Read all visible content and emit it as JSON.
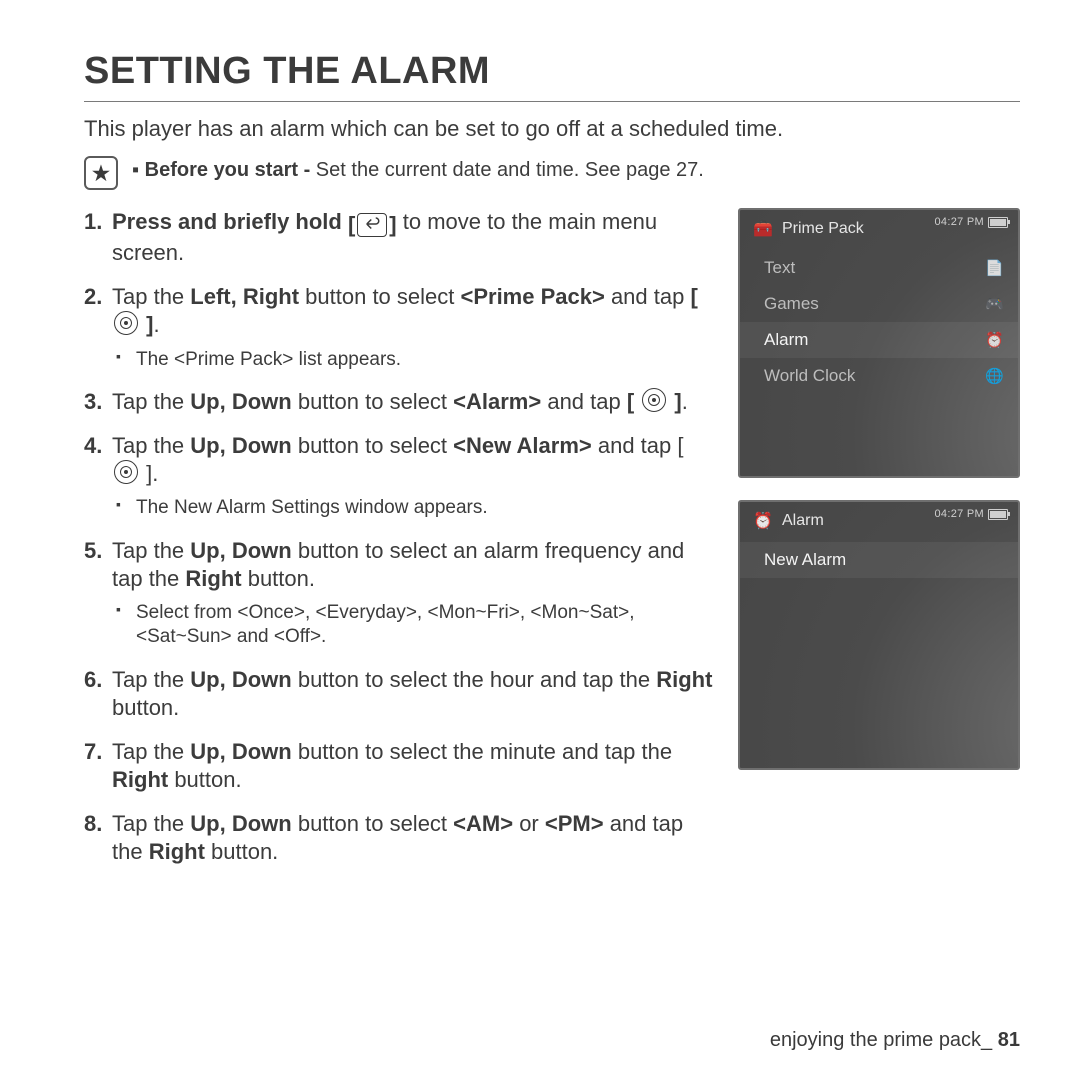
{
  "title": "SETTING THE ALARM",
  "intro": "This player has an alarm which can be set to go off at a scheduled time.",
  "note": {
    "lead": "Before you start -",
    "rest": " Set the current date and time. See page 27."
  },
  "steps": {
    "s1a": "Press and briefly hold ",
    "s1b": " to move to the main menu screen.",
    "s2a": "Tap the ",
    "s2b": "Left, Right",
    "s2c": " button to select ",
    "s2d": "<Prime Pack>",
    "s2e": " and tap ",
    "s2sub": "The <Prime Pack> list appears.",
    "s3a": "Tap the ",
    "s3b": "Up, Down",
    "s3c": " button to select ",
    "s3d": "<Alarm>",
    "s3e": " and tap ",
    "s4a": "Tap the ",
    "s4b": "Up, Down",
    "s4c": " button to select ",
    "s4d": "<New Alarm>",
    "s4e": " and tap ",
    "s4sub": "The New Alarm Settings window appears.",
    "s5a": "Tap the ",
    "s5b": "Up, Down",
    "s5c": " button to select an alarm frequency and tap the ",
    "s5d": "Right",
    "s5e": " button.",
    "s5sub": "Select from <Once>, <Everyday>, <Mon~Fri>, <Mon~Sat>, <Sat~Sun> and <Off>.",
    "s6a": "Tap the ",
    "s6b": "Up, Down",
    "s6c": " button to select the hour and tap the ",
    "s6d": "Right",
    "s6e": " button.",
    "s7a": "Tap the ",
    "s7b": "Up, Down",
    "s7c": " button to select the minute and tap the ",
    "s7d": "Right",
    "s7e": " button.",
    "s8a": "Tap the ",
    "s8b": "Up, Down",
    "s8c": " button to select ",
    "s8d": "<AM>",
    "s8e": " or ",
    "s8f": "<PM>",
    "s8g": " and tap the ",
    "s8h": "Right",
    "s8i": " button."
  },
  "device1": {
    "time": "04:27 PM",
    "title": "Prime Pack",
    "items": [
      "Text",
      "Games",
      "Alarm",
      "World Clock"
    ],
    "icons": [
      "📄",
      "🎮",
      "⏰",
      "🌐"
    ]
  },
  "device2": {
    "time": "04:27 PM",
    "title": "Alarm",
    "items": [
      "New Alarm"
    ]
  },
  "footer": {
    "section": "enjoying the prime pack_ ",
    "page": "81"
  }
}
